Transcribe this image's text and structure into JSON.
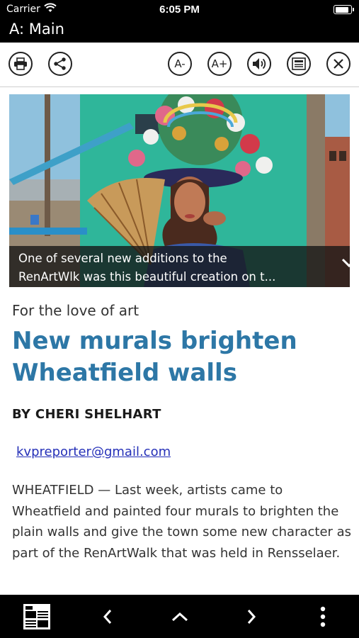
{
  "status": {
    "carrier": "Carrier",
    "time": "6:05 PM",
    "battery_level": 1.0
  },
  "header": {
    "title": "A: Main"
  },
  "toolbar": {
    "buttons": [
      {
        "name": "print",
        "icon": "printer-icon"
      },
      {
        "name": "share",
        "icon": "share-icon"
      },
      {
        "name": "decrease-font",
        "label": "A-"
      },
      {
        "name": "increase-font",
        "label": "A+"
      },
      {
        "name": "audio",
        "icon": "speaker-icon"
      },
      {
        "name": "text-view",
        "icon": "article-icon"
      },
      {
        "name": "close",
        "icon": "close-icon"
      }
    ],
    "font_smaller": "A-",
    "font_larger": "A+"
  },
  "article": {
    "image_caption_line1": "One of several new additions to the",
    "image_caption_line2": "RenArtWlk was this beautiful creation on t...",
    "kicker": "For the love of art",
    "headline": "New murals brighten Wheatfield walls",
    "byline": "BY CHERI SHELHART",
    "email": "kvpreporter@gmail.com",
    "body": "WHEATFIELD — Last week, artists came to Wheatfield and painted four murals to brighten the plain walls and give the town some new character as part of the RenArtWalk that was held in Rensselaer."
  },
  "bottom_nav": {
    "items": [
      "newspaper-icon",
      "chevron-left-icon",
      "chevron-up-icon",
      "chevron-right-icon",
      "more-vertical-icon"
    ]
  },
  "colors": {
    "headline": "#2d77a6",
    "link": "#2530b8",
    "bars": "#000000"
  }
}
